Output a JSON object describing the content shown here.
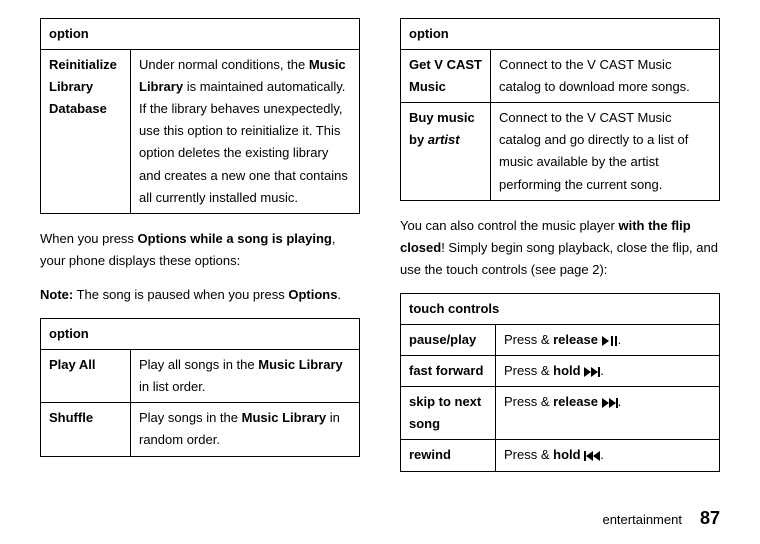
{
  "left": {
    "table1": {
      "header": "option",
      "row1_label": "Reinitialize Library Database",
      "row1_desc_pre": "Under normal conditions, the ",
      "row1_desc_bold": "Music Library",
      "row1_desc_post": " is maintained automatically. If the library behaves unexpectedly, use this option to reinitialize it. This option deletes the existing library and creates a new one that contains all currently installed music."
    },
    "para1_pre": "When you press ",
    "para1_cond": "Options",
    "para1_bold": " while a song is playing",
    "para1_post": ", your phone displays these options:",
    "note_label": "Note:",
    "note_text_pre": " The song is paused when you press ",
    "note_cond": "Options",
    "note_post": ".",
    "table2": {
      "header": "option",
      "r1_label": "Play All",
      "r1_pre": "Play all songs in the ",
      "r1_bold": "Music Library",
      "r1_post": " in list order.",
      "r2_label": "Shuffle",
      "r2_pre": "Play songs in the ",
      "r2_bold": "Music Library",
      "r2_post": " in random order."
    }
  },
  "right": {
    "table1": {
      "header": "option",
      "r1_label": "Get V CAST Music",
      "r1_desc": "Connect to the V CAST Music catalog to download more songs.",
      "r2_label_pre": "Buy music by ",
      "r2_label_it": "artist",
      "r2_desc": "Connect to the V CAST Music catalog and go directly to a list of music available by the artist performing the current song."
    },
    "para_pre": "You can also control the music player ",
    "para_bold": "with the flip closed",
    "para_post": "! Simply begin song playback, close the flip, and use the touch controls (see page 2):",
    "touch": {
      "header": "touch controls",
      "r1_label": "pause/play",
      "r1_pre": "Press & ",
      "r1_b": "release",
      "r1_post": " ",
      "r1_end": ".",
      "r2_label": "fast forward",
      "r2_pre": "Press & ",
      "r2_b": "hold",
      "r2_post": " ",
      "r2_end": ".",
      "r3_label": "skip to next song",
      "r3_pre": "Press & ",
      "r3_b": "release",
      "r3_post": " ",
      "r3_end": ".",
      "r4_label": "rewind",
      "r4_pre": "Press & ",
      "r4_b": "hold",
      "r4_post": " ",
      "r4_end": "."
    }
  },
  "footer": {
    "section": "entertainment",
    "page": "87"
  }
}
